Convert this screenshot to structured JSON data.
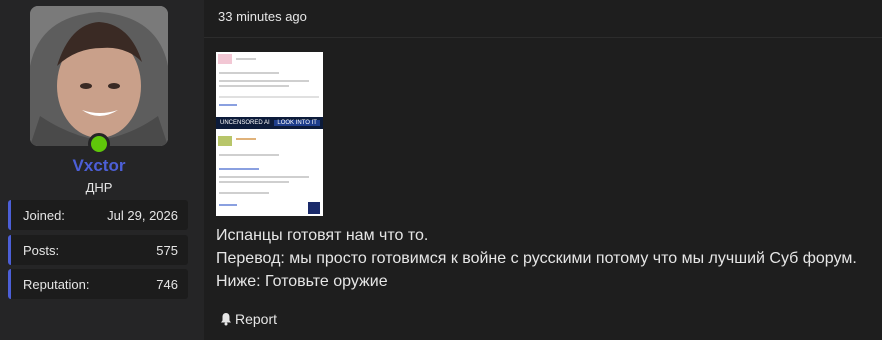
{
  "user": {
    "name": "Vxctor",
    "title": "ДНР",
    "stats": [
      {
        "label": "Joined:",
        "value": "Jul 29, 2026"
      },
      {
        "label": "Posts:",
        "value": "575"
      },
      {
        "label": "Reputation:",
        "value": "746"
      }
    ],
    "online_color": "#5fc70a",
    "name_color": "#4c5fd7"
  },
  "post": {
    "timestamp": "33 minutes ago",
    "lines": [
      "Испанцы готовят нам что то.",
      "Перевод: мы просто готовимся к войне с русскими потому что мы лучший Суб форум.",
      "Ниже: Готовьте оружие"
    ],
    "attachment_banner": {
      "left": "UNCENSORED AI",
      "right": "LOOK INTO IT"
    },
    "report_label": "Report",
    "report_icon": "bell-icon"
  }
}
